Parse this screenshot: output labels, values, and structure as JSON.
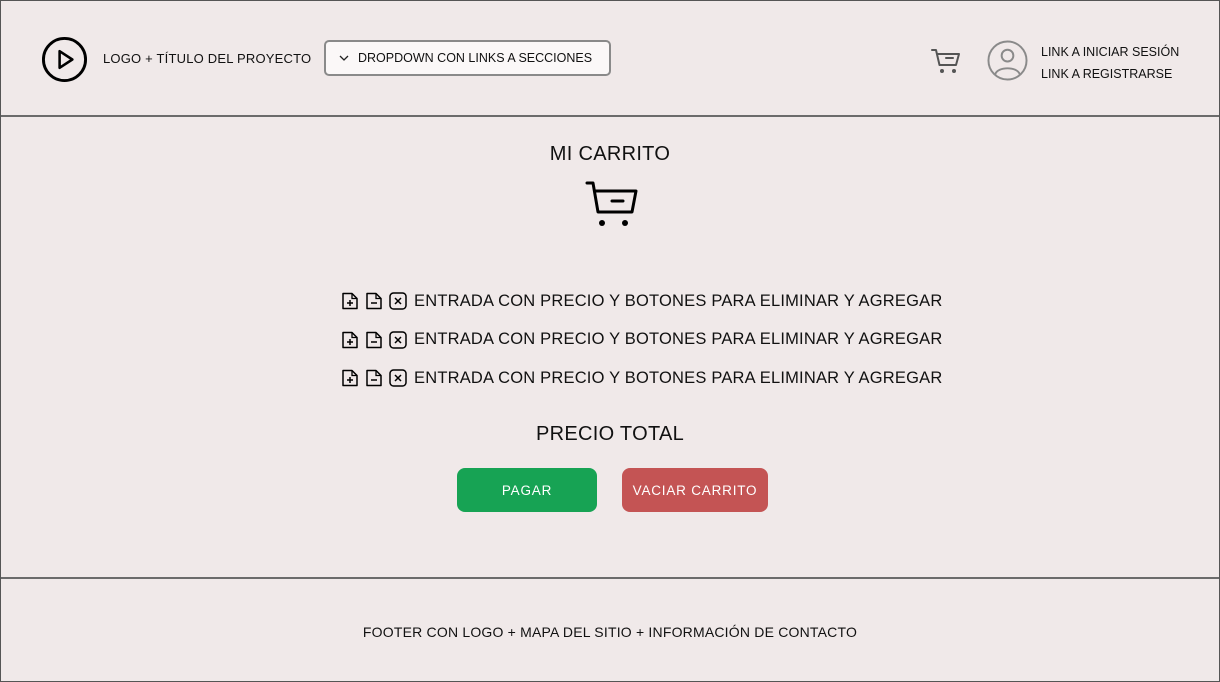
{
  "header": {
    "logo_icon": "play-circle-icon",
    "logo_text": "LOGO + TÍTULO DEL PROYECTO",
    "dropdown_label": "DROPDOWN CON LINKS A SECCIONES",
    "cart_icon": "cart-icon",
    "avatar_icon": "user-avatar-icon",
    "login_link": "LINK A INICIAR SESIÓN",
    "register_link": "LINK A REGISTRARSE"
  },
  "main": {
    "title": "MI CARRITO",
    "entries": [
      {
        "text": "ENTRADA CON PRECIO Y BOTONES PARA ELIMINAR Y AGREGAR"
      },
      {
        "text": "ENTRADA CON PRECIO Y BOTONES PARA ELIMINAR Y AGREGAR"
      },
      {
        "text": "ENTRADA CON PRECIO Y BOTONES PARA ELIMINAR Y AGREGAR"
      }
    ],
    "total_label": "PRECIO TOTAL",
    "pay_button": "PAGAR",
    "empty_button": "VACIAR CARRITO"
  },
  "footer": {
    "text": "FOOTER CON LOGO + MAPA DEL SITIO + INFORMACIÓN DE CONTACTO"
  },
  "colors": {
    "background": "#f0e9e9",
    "pay": "#17a354",
    "empty": "#c45454"
  }
}
